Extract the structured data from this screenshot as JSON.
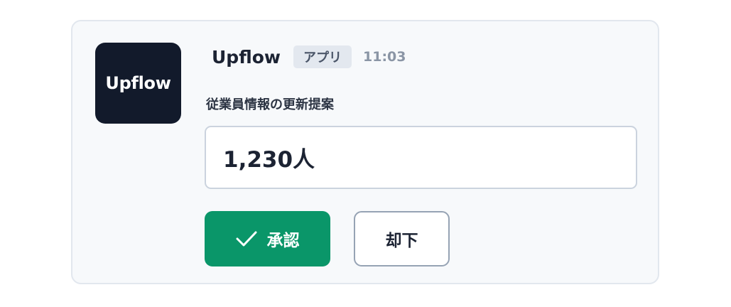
{
  "app": {
    "logo_text": "Upflow",
    "name": "Upflow",
    "badge": "アプリ",
    "time": "11:03"
  },
  "message": {
    "label": "従業員情報の更新提案",
    "value": "1,230人"
  },
  "actions": {
    "approve_label": "承認",
    "approve_icon": "check-icon",
    "reject_label": "却下"
  },
  "colors": {
    "approve": "#0a9669",
    "logo_bg": "#121a2b"
  }
}
